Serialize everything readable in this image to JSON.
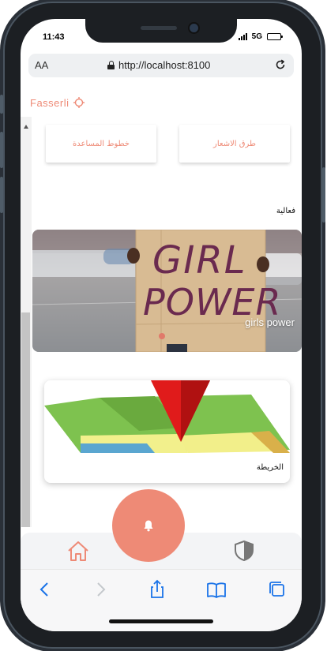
{
  "status_bar": {
    "time": "11:43",
    "network": "5G"
  },
  "browser": {
    "aa_label": "AA",
    "url": "http://localhost:8100"
  },
  "app": {
    "logo_text": "Fasserli"
  },
  "quick_links": [
    {
      "label": "خطوط المساعدة"
    },
    {
      "label": "طرق الاشعار"
    }
  ],
  "activity": {
    "title": "فعالية",
    "event_caption": "girls power",
    "sign_line1": "GIRL",
    "sign_line2": "POWER"
  },
  "map": {
    "label": "الخريطة"
  },
  "colors": {
    "accent": "#ee8a76",
    "ios_blue": "#1a73e8"
  },
  "icons": {
    "fab": "bell-icon",
    "home_tab": "home-icon",
    "shield_tab": "shield-icon",
    "toolbar": [
      "back-icon",
      "forward-icon",
      "share-icon",
      "bookmarks-icon",
      "tabs-icon"
    ]
  }
}
